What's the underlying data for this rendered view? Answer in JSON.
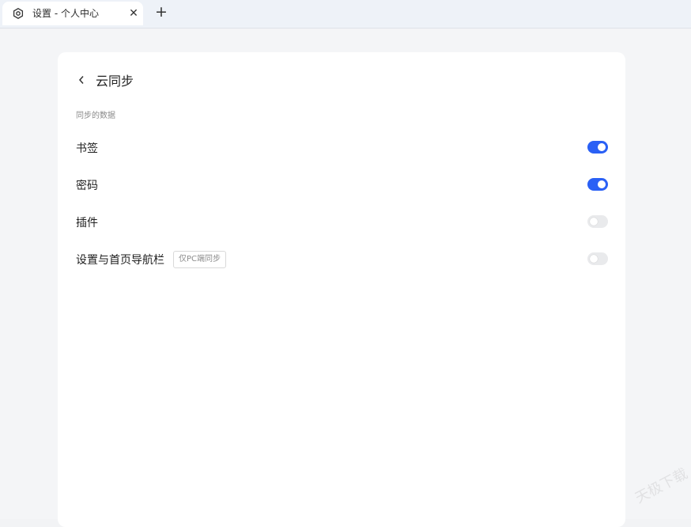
{
  "tabbar": {
    "tab": {
      "title": "设置 - 个人中心",
      "close_label": "✕",
      "icon": "settings-gear-icon"
    },
    "new_tab_label": "+"
  },
  "page": {
    "back_label": "‹",
    "title": "云同步",
    "section_label": "同步的数据"
  },
  "sync_items": [
    {
      "label": "书签",
      "enabled": true
    },
    {
      "label": "密码",
      "enabled": true
    },
    {
      "label": "插件",
      "enabled": false
    },
    {
      "label": "设置与首页导航栏",
      "badge": "仅PC端同步",
      "enabled": false
    }
  ],
  "colors": {
    "accent": "#2a60f5",
    "toggle_off": "#e9eaec"
  },
  "watermark": "天极下载"
}
